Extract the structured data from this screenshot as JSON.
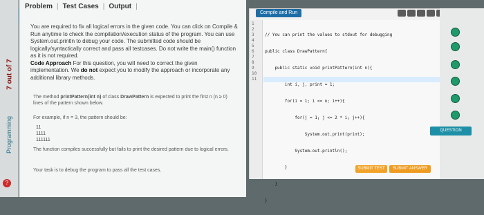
{
  "tabs": {
    "problem": "Problem",
    "test_cases": "Test Cases",
    "output": "Output",
    "separator": "|"
  },
  "sidebar": {
    "progress": "7 out of 7",
    "label2": "Programming"
  },
  "problem_text": {
    "intro": "You are required to fix all logical errors in the given code. You can click on Compile & Run anytime to check the compilation/execution status of the program. You can use System.out.println to debug your code. The submitted code should be logically/syntactically correct and pass all testcases. Do not write the main() function as it is not required.",
    "approach_label": "Code Approach",
    "approach_text": "For this question, you will need to correct the given implementation. We",
    "do_not": "do not",
    "approach_tail": "expect you to modify the approach or incorporate any additional library methods.",
    "method_line_pre": "The method ",
    "method_name": "printPattern(int n)",
    "method_mid": " of class ",
    "class_name": "DrawPattern",
    "method_tail": " is expected to print the first n (n ≥ 0) lines of the pattern shown below.",
    "example": "For example, if n = 3, the pattern should be:",
    "pattern": [
      "11",
      "1111",
      "111111"
    ],
    "compile_note": "The function compiles successfully but fails to print the desired pattern due to logical errors.",
    "task": "Your task is to debug the program to pass all the test cases."
  },
  "editor": {
    "run_label": "Compile and Run",
    "line_numbers": [
      "1",
      "2",
      "3",
      "4",
      "5",
      "6",
      "7",
      "8",
      "9",
      "10",
      "11"
    ],
    "code_lines": [
      "// You can print the values to stdout for debugging",
      "public class DrawPattern{",
      "    public static void printPattern(int n){",
      "        int i, j, print = 1;",
      "        for(i = 1; i <= n; i++){",
      "            for(j = 1; j <= 2 * i; j++){",
      "                System.out.print(print);",
      "            System.out.println();",
      "        }",
      "    }",
      "}"
    ]
  },
  "right_panel": {
    "question": "QUESTION",
    "submit_test": "SUBMIT TEST",
    "submit_answer": "SUBMIT ANSWER"
  },
  "help": {
    "label": "HELP"
  }
}
